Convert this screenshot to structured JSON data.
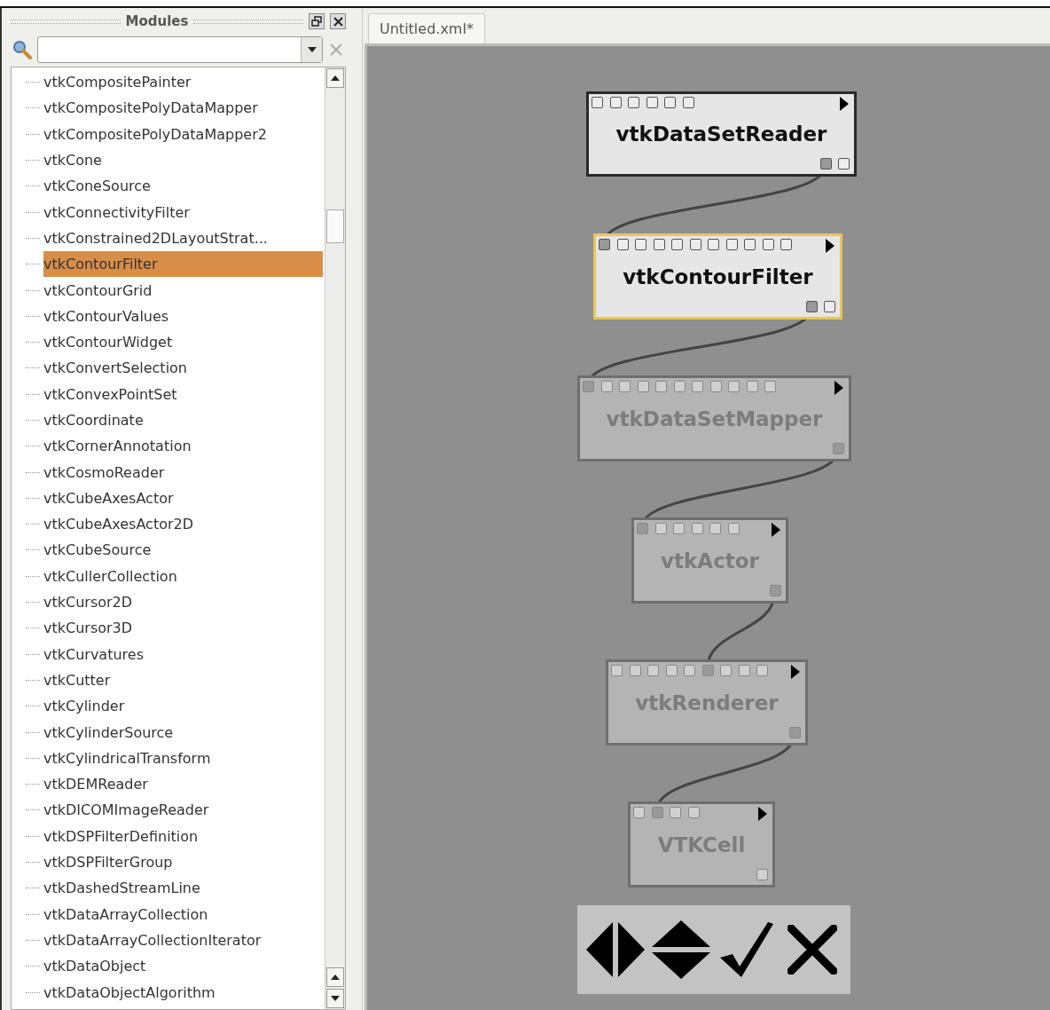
{
  "modules_panel": {
    "title": "Modules",
    "items": [
      {
        "label": "vtkCompositePainter",
        "selected": false
      },
      {
        "label": "vtkCompositePolyDataMapper",
        "selected": false
      },
      {
        "label": "vtkCompositePolyDataMapper2",
        "selected": false
      },
      {
        "label": "vtkCone",
        "selected": false
      },
      {
        "label": "vtkConeSource",
        "selected": false
      },
      {
        "label": "vtkConnectivityFilter",
        "selected": false
      },
      {
        "label": "vtkConstrained2DLayoutStrat...",
        "selected": false
      },
      {
        "label": "vtkContourFilter",
        "selected": true
      },
      {
        "label": "vtkContourGrid",
        "selected": false
      },
      {
        "label": "vtkContourValues",
        "selected": false
      },
      {
        "label": "vtkContourWidget",
        "selected": false
      },
      {
        "label": "vtkConvertSelection",
        "selected": false
      },
      {
        "label": "vtkConvexPointSet",
        "selected": false
      },
      {
        "label": "vtkCoordinate",
        "selected": false
      },
      {
        "label": "vtkCornerAnnotation",
        "selected": false
      },
      {
        "label": "vtkCosmoReader",
        "selected": false
      },
      {
        "label": "vtkCubeAxesActor",
        "selected": false
      },
      {
        "label": "vtkCubeAxesActor2D",
        "selected": false
      },
      {
        "label": "vtkCubeSource",
        "selected": false
      },
      {
        "label": "vtkCullerCollection",
        "selected": false
      },
      {
        "label": "vtkCursor2D",
        "selected": false
      },
      {
        "label": "vtkCursor3D",
        "selected": false
      },
      {
        "label": "vtkCurvatures",
        "selected": false
      },
      {
        "label": "vtkCutter",
        "selected": false
      },
      {
        "label": "vtkCylinder",
        "selected": false
      },
      {
        "label": "vtkCylinderSource",
        "selected": false
      },
      {
        "label": "vtkCylindricalTransform",
        "selected": false
      },
      {
        "label": "vtkDEMReader",
        "selected": false
      },
      {
        "label": "vtkDICOMImageReader",
        "selected": false
      },
      {
        "label": "vtkDSPFilterDefinition",
        "selected": false
      },
      {
        "label": "vtkDSPFilterGroup",
        "selected": false
      },
      {
        "label": "vtkDashedStreamLine",
        "selected": false
      },
      {
        "label": "vtkDataArrayCollection",
        "selected": false
      },
      {
        "label": "vtkDataArrayCollectionIterator",
        "selected": false
      },
      {
        "label": "vtkDataObject",
        "selected": false
      },
      {
        "label": "vtkDataObjectAlgorithm",
        "selected": false
      }
    ]
  },
  "tabs": [
    {
      "label": "Untitled.xml*",
      "selected": true
    }
  ],
  "pipeline": {
    "modules": [
      {
        "name": "vtkDataSetReader",
        "selected": false,
        "enabled": true,
        "input_ports": [
          {
            "connected": false
          },
          {
            "connected": false
          },
          {
            "connected": false
          },
          {
            "connected": false
          },
          {
            "connected": false
          },
          {
            "connected": false
          }
        ],
        "output_ports": [
          {
            "connected": true
          },
          {
            "connected": false
          }
        ]
      },
      {
        "name": "vtkContourFilter",
        "selected": true,
        "enabled": true,
        "input_ports": [
          {
            "connected": true
          },
          {
            "connected": false
          },
          {
            "connected": false
          },
          {
            "connected": false
          },
          {
            "connected": false
          },
          {
            "connected": false
          },
          {
            "connected": false
          },
          {
            "connected": false
          },
          {
            "connected": false
          },
          {
            "connected": false
          },
          {
            "connected": false
          }
        ],
        "output_ports": [
          {
            "connected": true
          },
          {
            "connected": false
          }
        ]
      },
      {
        "name": "vtkDataSetMapper",
        "selected": false,
        "enabled": false,
        "input_ports": [
          {
            "connected": true
          },
          {
            "connected": false
          },
          {
            "connected": false
          },
          {
            "connected": false
          },
          {
            "connected": false
          },
          {
            "connected": false
          },
          {
            "connected": false
          },
          {
            "connected": false
          },
          {
            "connected": false
          },
          {
            "connected": false
          },
          {
            "connected": false
          }
        ],
        "output_ports": [
          {
            "connected": true
          }
        ]
      },
      {
        "name": "vtkActor",
        "selected": false,
        "enabled": false,
        "input_ports": [
          {
            "connected": true
          },
          {
            "connected": false
          },
          {
            "connected": false
          },
          {
            "connected": false
          },
          {
            "connected": false
          },
          {
            "connected": false
          }
        ],
        "output_ports": [
          {
            "connected": true
          }
        ]
      },
      {
        "name": "vtkRenderer",
        "selected": false,
        "enabled": false,
        "input_ports": [
          {
            "connected": false
          },
          {
            "connected": false
          },
          {
            "connected": false
          },
          {
            "connected": false
          },
          {
            "connected": false
          },
          {
            "connected": true
          },
          {
            "connected": false
          },
          {
            "connected": false
          },
          {
            "connected": false
          }
        ],
        "output_ports": [
          {
            "connected": true
          }
        ]
      },
      {
        "name": "VTKCell",
        "selected": false,
        "enabled": false,
        "input_ports": [
          {
            "connected": false
          },
          {
            "connected": true
          },
          {
            "connected": false
          },
          {
            "connected": false
          }
        ],
        "output_ports": [
          {
            "connected": false
          }
        ]
      }
    ]
  },
  "toolbar": {
    "buttons": [
      {
        "kind": "horizontal"
      },
      {
        "kind": "vertical"
      },
      {
        "kind": "accept"
      },
      {
        "kind": "cancel"
      }
    ]
  }
}
